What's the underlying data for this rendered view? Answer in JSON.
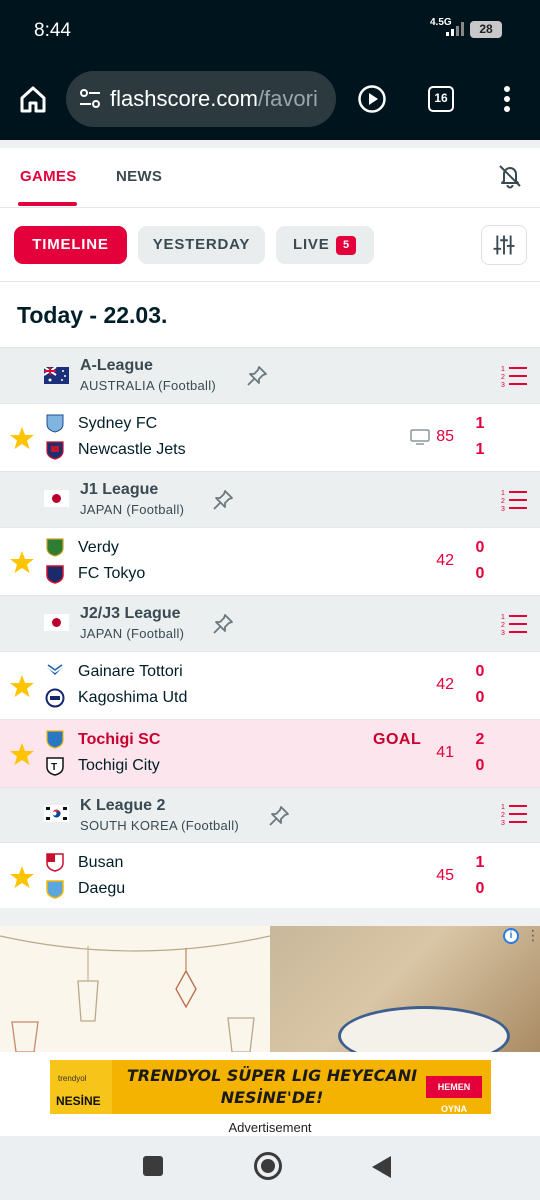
{
  "status_bar": {
    "time": "8:44",
    "network": "4.5G",
    "battery": "28"
  },
  "browser": {
    "url_host": "flashscore.com",
    "url_rest": "/favori",
    "tab_count": "16"
  },
  "nav": {
    "games": "GAMES",
    "news": "NEWS"
  },
  "filters": {
    "timeline": "TIMELINE",
    "yesterday": "YESTERDAY",
    "live": "LIVE",
    "live_count": "5"
  },
  "date_header": "Today - 22.03.",
  "leagues": [
    {
      "name": "A-League",
      "country": "AUSTRALIA",
      "sport": "(Football)",
      "flag": "flag-australia-icon"
    },
    {
      "name": "J1 League",
      "country": "JAPAN",
      "sport": "(Football)",
      "flag": "flag-japan-icon"
    },
    {
      "name": "J2/J3 League",
      "country": "JAPAN",
      "sport": "(Football)",
      "flag": "flag-japan-icon"
    },
    {
      "name": "K League 2",
      "country": "SOUTH KOREA",
      "sport": "(Football)",
      "flag": "flag-south-korea-icon"
    }
  ],
  "matches": [
    {
      "home": "Sydney FC",
      "away": "Newcastle Jets",
      "minute": "85",
      "home_score": "1",
      "away_score": "1",
      "tv": true,
      "favorite": true
    },
    {
      "home": "Verdy",
      "away": "FC Tokyo",
      "minute": "42",
      "home_score": "0",
      "away_score": "0",
      "favorite": true
    },
    {
      "home": "Gainare Tottori",
      "away": "Kagoshima Utd",
      "minute": "42",
      "home_score": "0",
      "away_score": "0",
      "favorite": true
    },
    {
      "home": "Tochigi SC",
      "away": "Tochigi City",
      "minute": "41",
      "home_score": "2",
      "away_score": "0",
      "status": "GOAL",
      "favorite": true
    },
    {
      "home": "Busan",
      "away": "Daegu",
      "minute": "45",
      "home_score": "1",
      "away_score": "0",
      "favorite": true
    }
  ],
  "ad": {
    "headline_line1": "TRENDYOL SÜPER LIG HEYECANI",
    "headline_line2": "NESİNE'DE!",
    "cta": "HEMEN OYNA",
    "brand": "trendyol",
    "brand2": "NESİNE",
    "label": "Advertisement"
  },
  "colors": {
    "accent": "#e4003b",
    "dark_bg": "#00141e",
    "league_bg": "#eceff0",
    "goal_row_bg": "#fce5ec",
    "star": "#ffc400"
  }
}
